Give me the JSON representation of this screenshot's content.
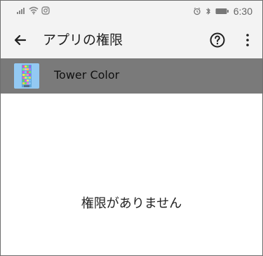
{
  "status_bar": {
    "time": "6:30",
    "icons": [
      "signal-icon",
      "wifi-icon",
      "instagram-icon",
      "alarm-icon",
      "bluetooth-icon",
      "battery-icon"
    ]
  },
  "app_bar": {
    "title": "アプリの権限",
    "back_icon": "back-arrow-icon",
    "help_icon": "help-icon",
    "menu_icon": "more-vert-icon"
  },
  "app": {
    "name": "Tower Color",
    "icon": "app-icon"
  },
  "content": {
    "empty_message": "権限がありません"
  },
  "colors": {
    "app_bar_bg": "#f3f3f3",
    "selected_row_bg": "#7a7a7a",
    "page_bg": "#ffffff"
  }
}
